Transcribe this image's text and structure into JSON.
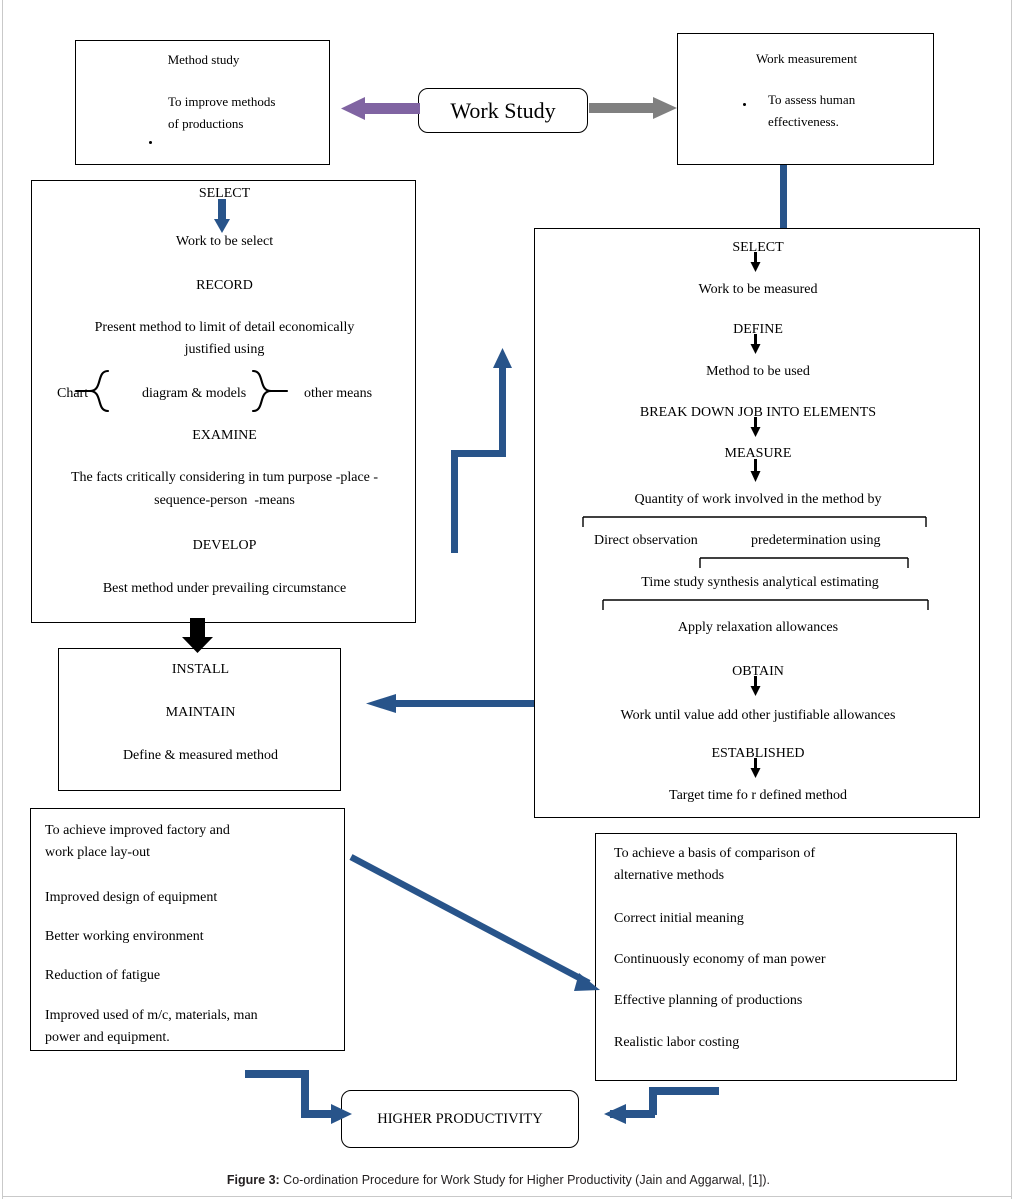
{
  "figure": {
    "caption_prefix": "Figure 3:",
    "caption_text": " Co-ordination Procedure for Work Study for Higher Productivity (Jain and Aggarwal, [1])."
  },
  "colors": {
    "arrow_blue": "#28548A",
    "arrow_purple": "#8064A2",
    "arrow_gray": "#808080",
    "arrow_black": "#000000",
    "box_border": "#000000",
    "page_bg": "#FFFFFF"
  },
  "center_node": {
    "label": "Work Study"
  },
  "method_study_box": {
    "title": "Method study",
    "bullets": [
      "To improve methods",
      "of productions"
    ]
  },
  "work_measurement_box": {
    "title": "Work measurement",
    "bullets": [
      "To assess human",
      "effectiveness."
    ]
  },
  "method_steps_box": {
    "lines": [
      "SELECT",
      "Work to be select",
      "RECORD",
      "Present method to limit of detail economically",
      "justified using",
      "EXAMINE",
      "The facts critically considering in tum purpose -place -",
      "sequence-person  -means",
      "DEVELOP",
      "Best method under prevailing circumstance"
    ],
    "brace_row": {
      "left_label": "Chart",
      "middle_label": "diagram & models",
      "right_label": "other means"
    }
  },
  "measurement_steps_box": {
    "lines": [
      "SELECT",
      "Work to be measured",
      "DEFINE",
      "Method to be used",
      "BREAK DOWN JOB INTO ELEMENTS",
      "MEASURE",
      "Quantity of work involved in the method by",
      "Apply relaxation allowances",
      "OBTAIN",
      "Work until value add other justifiable allowances",
      "ESTABLISHED",
      "Target time fo r defined method"
    ],
    "bracket_rows": {
      "row1_left": "Direct observation",
      "row1_right": "predetermination using",
      "row2": "Time study synthesis analytical estimating"
    }
  },
  "install_box": {
    "lines": [
      "INSTALL",
      "MAINTAIN",
      "Define & measured method"
    ]
  },
  "left_outcomes_box": {
    "items": [
      "To achieve improved factory and",
      "work place lay-out",
      "Improved design of equipment",
      "Better working environment",
      "Reduction of fatigue",
      "Improved used of m/c, materials, man",
      "power and equipment."
    ]
  },
  "right_outcomes_box": {
    "items": [
      "To achieve a basis of comparison of",
      "alternative methods",
      "Correct initial meaning",
      "Continuously economy of man power",
      "Effective planning of productions",
      "Realistic labor costing"
    ]
  },
  "result_node": {
    "label": "HIGHER PRODUCTIVITY"
  }
}
